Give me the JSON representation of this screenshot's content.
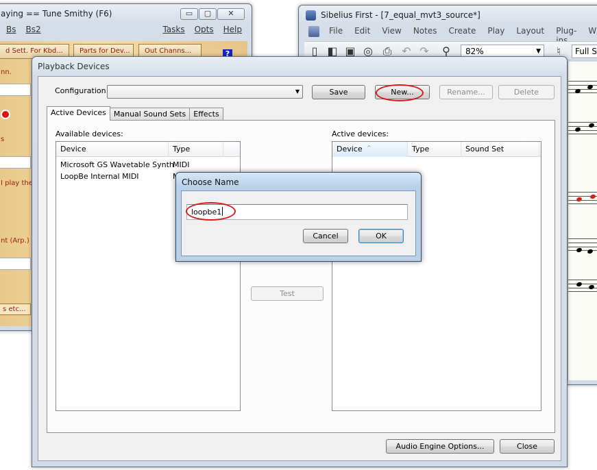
{
  "tune_smithy": {
    "title": "aying == Tune Smithy (F6)",
    "menu": [
      "Bs",
      "Bs2"
    ],
    "menu_right": [
      "Tasks",
      "Opts",
      "Help"
    ],
    "buttons": [
      "d Sett. For Kbd...",
      "Parts for Dev...",
      "Out Channs..."
    ],
    "help_symbol": "?",
    "side_texts": [
      "nn.",
      "s",
      "I play the",
      "nt (Arp.)",
      "s etc..."
    ],
    "caption_buttons": [
      "▭",
      "▢",
      "✕"
    ]
  },
  "sibelius": {
    "title": "Sibelius First - [7_equal_mvt3_source*]",
    "menu": [
      "File",
      "Edit",
      "View",
      "Notes",
      "Create",
      "Play",
      "Layout",
      "Plug-ins",
      "Window"
    ],
    "zoom": "82%",
    "view_mode": "Full Sco"
  },
  "playback_devices": {
    "title": "Playback Devices",
    "configuration_label": "Configuration:",
    "configuration_value": "",
    "buttons": {
      "save": "Save",
      "new": "New...",
      "rename": "Rename...",
      "delete": "Delete",
      "test": "Test",
      "audio_engine": "Audio Engine Options...",
      "close": "Close"
    },
    "tabs": [
      "Active Devices",
      "Manual Sound Sets",
      "Effects"
    ],
    "available_label": "Available devices:",
    "available_columns": [
      "Device",
      "Type"
    ],
    "available_rows": [
      {
        "device": "Microsoft GS Wavetable Synth",
        "type": "MIDI"
      },
      {
        "device": "LoopBe Internal MIDI",
        "type": "M"
      }
    ],
    "active_label": "Active devices:",
    "active_columns": [
      "Device",
      "Type",
      "Sound Set"
    ],
    "sort_glyph": "^"
  },
  "choose_name": {
    "title": "Choose Name",
    "value": "loopbe1",
    "cancel": "Cancel",
    "ok": "OK"
  },
  "colors": {
    "highlight_ring": "#d41c1c",
    "tune_smithy_bg": "#f2dca8",
    "tune_smithy_text": "#8a1a10"
  }
}
